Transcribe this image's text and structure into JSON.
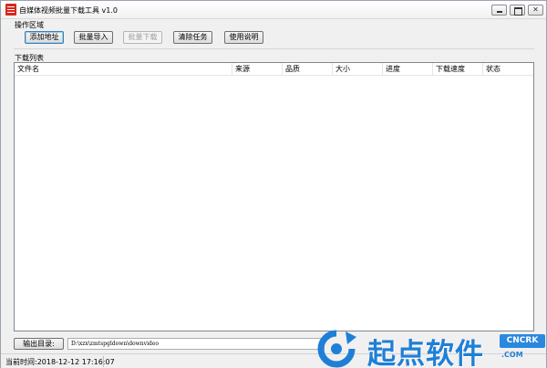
{
  "window": {
    "title": "自媒体视频批量下载工具 v1.0"
  },
  "operations": {
    "group_label": "操作区域",
    "buttons": {
      "add": "添加地址",
      "import": "批量导入",
      "batch_download": "批量下载",
      "clear": "清除任务",
      "help": "使用说明"
    }
  },
  "download_list": {
    "group_label": "下载列表",
    "columns": [
      "文件名",
      "来源",
      "品质",
      "大小",
      "进度",
      "下载速度",
      "状态"
    ],
    "rows": []
  },
  "output": {
    "button_label": "输出目录:",
    "path": "D:\\xzx\\zmtspgldown\\downvideo"
  },
  "status": {
    "current_time": "当前时间:2018-12-12 17:16:07"
  },
  "watermark": {
    "text": "起点软件",
    "badge": "CNCRK",
    "url": ".COM"
  },
  "colors": {
    "accent": "#1f7fd6",
    "app_icon": "#d9261c"
  }
}
